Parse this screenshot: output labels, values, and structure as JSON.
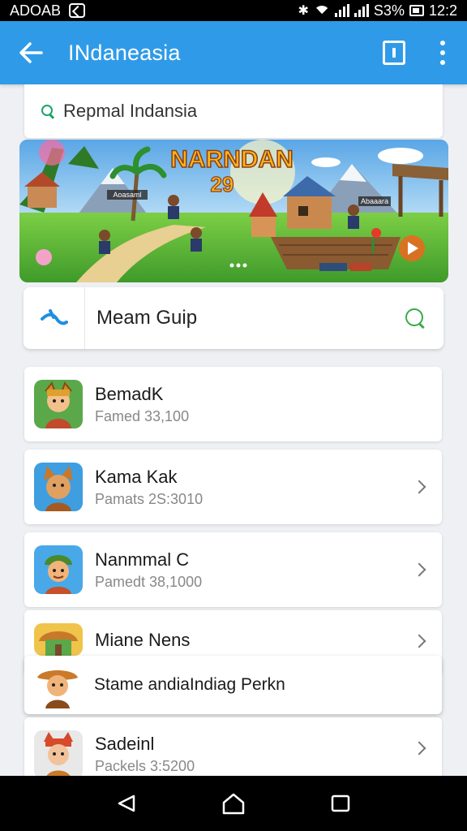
{
  "status_bar": {
    "left_text": "ADOAB",
    "battery_text": "S3%",
    "time": "12:2"
  },
  "app_bar": {
    "title": "INdaneasia"
  },
  "search": {
    "text": "Repmal Indansia"
  },
  "banner": {
    "title": "NARNDAN",
    "number": "29",
    "sign_left": "Aoasaml",
    "sign_right": "Abaaara"
  },
  "quick_access": {
    "label": "Meam Guip"
  },
  "games": [
    {
      "name": "BemadK",
      "subtitle": "Famed 33,100",
      "icon": "warrior-avatar-icon"
    },
    {
      "name": "Kama Kak",
      "subtitle": "Pamats 2S:3010",
      "icon": "fox-avatar-icon"
    },
    {
      "name": "Nanmmal C",
      "subtitle": "Pamedt 38,1000",
      "icon": "soldier-avatar-icon"
    },
    {
      "name": "Miane Nens",
      "subtitle": "",
      "icon": "house-avatar-icon"
    },
    {
      "name": "Sadeinl",
      "subtitle": "Packels 3:5200",
      "icon": "mouse-avatar-icon"
    }
  ],
  "toast": {
    "text": "Stame andiaIndiag Perkn",
    "icon": "cowboy-avatar-icon"
  },
  "colors": {
    "app_bar": "#2f9be8",
    "accent_green": "#3aaa4a",
    "background": "#eef0f3"
  }
}
